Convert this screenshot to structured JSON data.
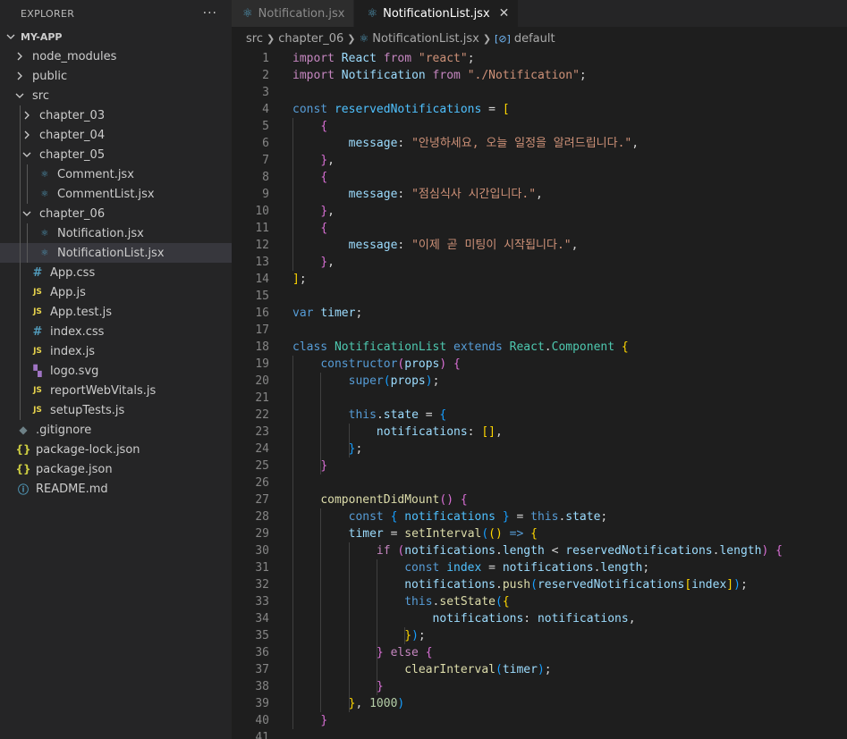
{
  "explorer": {
    "title": "EXPLORER",
    "more": "···",
    "project": "MY-APP",
    "tree": [
      {
        "label": "node_modules",
        "type": "folder",
        "open": false,
        "depth": 0
      },
      {
        "label": "public",
        "type": "folder",
        "open": false,
        "depth": 0
      },
      {
        "label": "src",
        "type": "folder",
        "open": true,
        "depth": 0
      },
      {
        "label": "chapter_03",
        "type": "folder",
        "open": false,
        "depth": 1
      },
      {
        "label": "chapter_04",
        "type": "folder",
        "open": false,
        "depth": 1
      },
      {
        "label": "chapter_05",
        "type": "folder",
        "open": true,
        "depth": 1
      },
      {
        "label": "Comment.jsx",
        "type": "react",
        "depth": 2
      },
      {
        "label": "CommentList.jsx",
        "type": "react",
        "depth": 2
      },
      {
        "label": "chapter_06",
        "type": "folder",
        "open": true,
        "depth": 1
      },
      {
        "label": "Notification.jsx",
        "type": "react",
        "depth": 2
      },
      {
        "label": "NotificationList.jsx",
        "type": "react",
        "depth": 2,
        "selected": true
      },
      {
        "label": "App.css",
        "type": "css",
        "depth": 1
      },
      {
        "label": "App.js",
        "type": "js",
        "depth": 1
      },
      {
        "label": "App.test.js",
        "type": "js",
        "depth": 1
      },
      {
        "label": "index.css",
        "type": "css",
        "depth": 1
      },
      {
        "label": "index.js",
        "type": "js",
        "depth": 1
      },
      {
        "label": "logo.svg",
        "type": "svg",
        "depth": 1
      },
      {
        "label": "reportWebVitals.js",
        "type": "js",
        "depth": 1
      },
      {
        "label": "setupTests.js",
        "type": "js",
        "depth": 1
      },
      {
        "label": ".gitignore",
        "type": "git",
        "depth": 0
      },
      {
        "label": "package-lock.json",
        "type": "json",
        "depth": 0
      },
      {
        "label": "package.json",
        "type": "json",
        "depth": 0
      },
      {
        "label": "README.md",
        "type": "info",
        "depth": 0
      }
    ]
  },
  "tabs": [
    {
      "label": "Notification.jsx",
      "active": false
    },
    {
      "label": "NotificationList.jsx",
      "active": true,
      "close": "✕"
    }
  ],
  "breadcrumb": {
    "src": "src",
    "folder": "chapter_06",
    "file": "NotificationList.jsx",
    "symbol": "default"
  },
  "code_lines": [
    [
      [
        "kw2",
        "import"
      ],
      [
        "pun",
        " "
      ],
      [
        "var",
        "React"
      ],
      [
        "pun",
        " "
      ],
      [
        "kw2",
        "from"
      ],
      [
        "pun",
        " "
      ],
      [
        "str",
        "\"react\""
      ],
      [
        "pun",
        ";"
      ]
    ],
    [
      [
        "kw2",
        "import"
      ],
      [
        "pun",
        " "
      ],
      [
        "var",
        "Notification"
      ],
      [
        "pun",
        " "
      ],
      [
        "kw2",
        "from"
      ],
      [
        "pun",
        " "
      ],
      [
        "str",
        "\"./Notification\""
      ],
      [
        "pun",
        ";"
      ]
    ],
    [],
    [
      [
        "kw",
        "const"
      ],
      [
        "pun",
        " "
      ],
      [
        "const",
        "reservedNotifications"
      ],
      [
        "pun",
        " = "
      ],
      [
        "br1",
        "["
      ]
    ],
    [
      [
        "pun",
        "    "
      ],
      [
        "br2",
        "{"
      ]
    ],
    [
      [
        "pun",
        "        "
      ],
      [
        "var",
        "message"
      ],
      [
        "pun",
        ": "
      ],
      [
        "str",
        "\"안녕하세요, 오늘 일정을 알려드립니다.\""
      ],
      [
        "pun",
        ","
      ]
    ],
    [
      [
        "pun",
        "    "
      ],
      [
        "br2",
        "}"
      ],
      [
        "pun",
        ","
      ]
    ],
    [
      [
        "pun",
        "    "
      ],
      [
        "br2",
        "{"
      ]
    ],
    [
      [
        "pun",
        "        "
      ],
      [
        "var",
        "message"
      ],
      [
        "pun",
        ": "
      ],
      [
        "str",
        "\"점심식사 시간입니다.\""
      ],
      [
        "pun",
        ","
      ]
    ],
    [
      [
        "pun",
        "    "
      ],
      [
        "br2",
        "}"
      ],
      [
        "pun",
        ","
      ]
    ],
    [
      [
        "pun",
        "    "
      ],
      [
        "br2",
        "{"
      ]
    ],
    [
      [
        "pun",
        "        "
      ],
      [
        "var",
        "message"
      ],
      [
        "pun",
        ": "
      ],
      [
        "str",
        "\"이제 곧 미팅이 시작됩니다.\""
      ],
      [
        "pun",
        ","
      ]
    ],
    [
      [
        "pun",
        "    "
      ],
      [
        "br2",
        "}"
      ],
      [
        "pun",
        ","
      ]
    ],
    [
      [
        "br1",
        "]"
      ],
      [
        "pun",
        ";"
      ]
    ],
    [],
    [
      [
        "kw",
        "var"
      ],
      [
        "pun",
        " "
      ],
      [
        "var",
        "timer"
      ],
      [
        "pun",
        ";"
      ]
    ],
    [],
    [
      [
        "kw",
        "class"
      ],
      [
        "pun",
        " "
      ],
      [
        "cls",
        "NotificationList"
      ],
      [
        "pun",
        " "
      ],
      [
        "kw",
        "extends"
      ],
      [
        "pun",
        " "
      ],
      [
        "cls",
        "React"
      ],
      [
        "pun",
        "."
      ],
      [
        "cls",
        "Component"
      ],
      [
        "pun",
        " "
      ],
      [
        "br1",
        "{"
      ]
    ],
    [
      [
        "pun",
        "    "
      ],
      [
        "kw",
        "constructor"
      ],
      [
        "br2",
        "("
      ],
      [
        "var",
        "props"
      ],
      [
        "br2",
        ")"
      ],
      [
        "pun",
        " "
      ],
      [
        "br2",
        "{"
      ]
    ],
    [
      [
        "pun",
        "        "
      ],
      [
        "kw",
        "super"
      ],
      [
        "br3",
        "("
      ],
      [
        "var",
        "props"
      ],
      [
        "br3",
        ")"
      ],
      [
        "pun",
        ";"
      ]
    ],
    [],
    [
      [
        "pun",
        "        "
      ],
      [
        "kw",
        "this"
      ],
      [
        "pun",
        "."
      ],
      [
        "var",
        "state"
      ],
      [
        "pun",
        " = "
      ],
      [
        "br3",
        "{"
      ]
    ],
    [
      [
        "pun",
        "            "
      ],
      [
        "var",
        "notifications"
      ],
      [
        "pun",
        ": "
      ],
      [
        "br1",
        "[]"
      ],
      [
        "pun",
        ","
      ]
    ],
    [
      [
        "pun",
        "        "
      ],
      [
        "br3",
        "}"
      ],
      [
        "pun",
        ";"
      ]
    ],
    [
      [
        "pun",
        "    "
      ],
      [
        "br2",
        "}"
      ]
    ],
    [],
    [
      [
        "pun",
        "    "
      ],
      [
        "fn",
        "componentDidMount"
      ],
      [
        "br2",
        "()"
      ],
      [
        "pun",
        " "
      ],
      [
        "br2",
        "{"
      ]
    ],
    [
      [
        "pun",
        "        "
      ],
      [
        "kw",
        "const"
      ],
      [
        "pun",
        " "
      ],
      [
        "br3",
        "{"
      ],
      [
        "pun",
        " "
      ],
      [
        "const",
        "notifications"
      ],
      [
        "pun",
        " "
      ],
      [
        "br3",
        "}"
      ],
      [
        "pun",
        " = "
      ],
      [
        "kw",
        "this"
      ],
      [
        "pun",
        "."
      ],
      [
        "var",
        "state"
      ],
      [
        "pun",
        ";"
      ]
    ],
    [
      [
        "pun",
        "        "
      ],
      [
        "var",
        "timer"
      ],
      [
        "pun",
        " = "
      ],
      [
        "fn",
        "setInterval"
      ],
      [
        "br3",
        "("
      ],
      [
        "br1",
        "()"
      ],
      [
        "pun",
        " "
      ],
      [
        "kw",
        "=>"
      ],
      [
        "pun",
        " "
      ],
      [
        "br1",
        "{"
      ]
    ],
    [
      [
        "pun",
        "            "
      ],
      [
        "kw2",
        "if"
      ],
      [
        "pun",
        " "
      ],
      [
        "br2",
        "("
      ],
      [
        "var",
        "notifications"
      ],
      [
        "pun",
        "."
      ],
      [
        "var",
        "length"
      ],
      [
        "pun",
        " < "
      ],
      [
        "var",
        "reservedNotifications"
      ],
      [
        "pun",
        "."
      ],
      [
        "var",
        "length"
      ],
      [
        "br2",
        ")"
      ],
      [
        "pun",
        " "
      ],
      [
        "br2",
        "{"
      ]
    ],
    [
      [
        "pun",
        "                "
      ],
      [
        "kw",
        "const"
      ],
      [
        "pun",
        " "
      ],
      [
        "const",
        "index"
      ],
      [
        "pun",
        " = "
      ],
      [
        "var",
        "notifications"
      ],
      [
        "pun",
        "."
      ],
      [
        "var",
        "length"
      ],
      [
        "pun",
        ";"
      ]
    ],
    [
      [
        "pun",
        "                "
      ],
      [
        "var",
        "notifications"
      ],
      [
        "pun",
        "."
      ],
      [
        "fn",
        "push"
      ],
      [
        "br3",
        "("
      ],
      [
        "var",
        "reservedNotifications"
      ],
      [
        "br1",
        "["
      ],
      [
        "var",
        "index"
      ],
      [
        "br1",
        "]"
      ],
      [
        "br3",
        ")"
      ],
      [
        "pun",
        ";"
      ]
    ],
    [
      [
        "pun",
        "                "
      ],
      [
        "kw",
        "this"
      ],
      [
        "pun",
        "."
      ],
      [
        "fn",
        "setState"
      ],
      [
        "br3",
        "("
      ],
      [
        "br1",
        "{"
      ]
    ],
    [
      [
        "pun",
        "                    "
      ],
      [
        "var",
        "notifications"
      ],
      [
        "pun",
        ": "
      ],
      [
        "var",
        "notifications"
      ],
      [
        "pun",
        ","
      ]
    ],
    [
      [
        "pun",
        "                "
      ],
      [
        "br1",
        "}"
      ],
      [
        "br3",
        ")"
      ],
      [
        "pun",
        ";"
      ]
    ],
    [
      [
        "pun",
        "            "
      ],
      [
        "br2",
        "}"
      ],
      [
        "pun",
        " "
      ],
      [
        "kw2",
        "else"
      ],
      [
        "pun",
        " "
      ],
      [
        "br2",
        "{"
      ]
    ],
    [
      [
        "pun",
        "                "
      ],
      [
        "fn",
        "clearInterval"
      ],
      [
        "br3",
        "("
      ],
      [
        "var",
        "timer"
      ],
      [
        "br3",
        ")"
      ],
      [
        "pun",
        ";"
      ]
    ],
    [
      [
        "pun",
        "            "
      ],
      [
        "br2",
        "}"
      ]
    ],
    [
      [
        "pun",
        "        "
      ],
      [
        "br1",
        "}"
      ],
      [
        "pun",
        ", "
      ],
      [
        "num",
        "1000"
      ],
      [
        "br3",
        ")"
      ]
    ],
    [
      [
        "pun",
        "    "
      ],
      [
        "br2",
        "}"
      ]
    ],
    []
  ]
}
